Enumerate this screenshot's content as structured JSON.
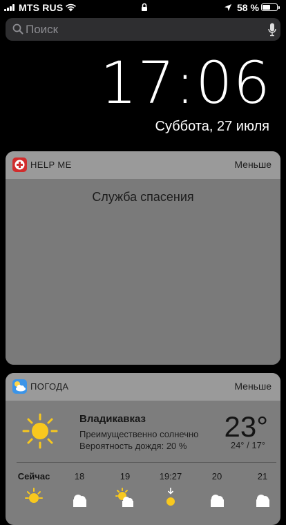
{
  "status": {
    "carrier": "MTS RUS",
    "battery_pct": "58 %",
    "battery_level": 0.58
  },
  "search": {
    "placeholder": "Поиск"
  },
  "clock": {
    "time": "17:06",
    "date": "Суббота, 27 июля"
  },
  "help_widget": {
    "app_name": "HELP ME",
    "less_label": "Меньше",
    "service_text": "Служба спасения"
  },
  "weather_widget": {
    "app_name": "ПОГОДА",
    "less_label": "Меньше",
    "city": "Владикавказ",
    "condition": "Преимущественно солнечно",
    "rain_chance": "Вероятность дождя: 20 %",
    "temp": "23°",
    "hilo": "24° / 17°",
    "hourly": [
      {
        "label": "Сейчас",
        "icon": "sun-icon"
      },
      {
        "label": "18",
        "icon": "cloud-icon"
      },
      {
        "label": "19",
        "icon": "partly-sunny-icon"
      },
      {
        "label": "19:27",
        "icon": "sunset-icon"
      },
      {
        "label": "20",
        "icon": "cloud-icon"
      },
      {
        "label": "21",
        "icon": "cloud-icon"
      }
    ]
  },
  "colors": {
    "help_icon": "#d12c2c",
    "weather_icon": "#3b94e8",
    "sun": "#f8c81e"
  }
}
